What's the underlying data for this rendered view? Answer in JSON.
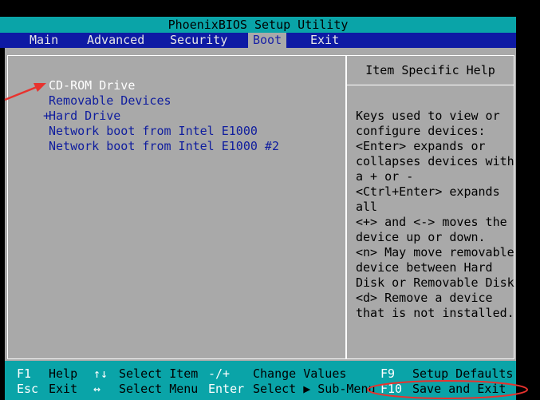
{
  "window": {
    "title": "PhoenixBIOS Setup Utility"
  },
  "menu": {
    "tabs": [
      {
        "label": "Main"
      },
      {
        "label": "Advanced"
      },
      {
        "label": "Security"
      },
      {
        "label": "Boot"
      },
      {
        "label": "Exit"
      }
    ],
    "active_tab": "Boot"
  },
  "boot_order": {
    "items": [
      {
        "label": "CD-ROM Drive",
        "selected": true
      },
      {
        "label": "Removable Devices"
      },
      {
        "label": "Hard Drive",
        "prefix": "+"
      },
      {
        "label": "Network boot from Intel E1000"
      },
      {
        "label": "Network boot from Intel E1000 #2"
      }
    ]
  },
  "help": {
    "title": "Item Specific Help",
    "lines": [
      "Keys used to view or",
      "configure devices:",
      "<Enter> expands or",
      "collapses devices with",
      "a + or -",
      "<Ctrl+Enter> expands",
      "all",
      "<+> and <-> moves the",
      "device up or down.",
      "<n> May move removable",
      "device between Hard",
      "Disk or Removable Disk",
      "<d> Remove a device",
      "that is not installed."
    ]
  },
  "footer": {
    "row1": [
      {
        "key": "F1",
        "desc": "Help"
      },
      {
        "key": "↑↓",
        "desc": "Select Item"
      },
      {
        "key": "-/+",
        "desc": "Change Values"
      },
      {
        "key": "F9",
        "desc": "Setup Defaults"
      }
    ],
    "row2": [
      {
        "key": "Esc",
        "desc": "Exit"
      },
      {
        "key": "↔",
        "desc": "Select Menu"
      },
      {
        "key": "Enter",
        "desc": "Select ▶ Sub-Menu"
      },
      {
        "key": "F10",
        "desc": "Save and Exit"
      }
    ]
  },
  "annotation": {
    "arrow_color": "#e8322e",
    "ellipse_color": "#e8322e"
  },
  "colors": {
    "title_bg": "#0aa4a8",
    "menu_bg": "#0e1aa4",
    "panel_bg": "#a9a9a9",
    "item_text": "#0f1d9e",
    "selected_text": "#ffffff"
  }
}
